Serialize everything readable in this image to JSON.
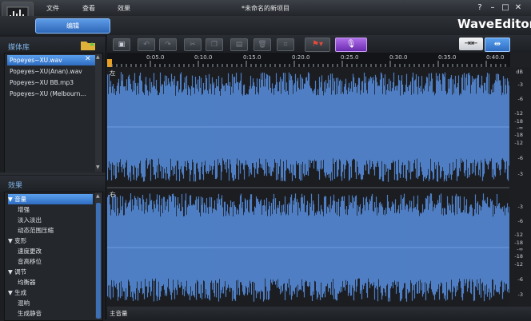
{
  "window": {
    "document_title": "*未命名的新项目",
    "brand": "WaveEditor",
    "menu": [
      "文件",
      "查看",
      "效果"
    ],
    "ribbon_tab": "编辑",
    "controls": {
      "help": "?",
      "minimize": "–",
      "maximize": "□",
      "close": "✕"
    }
  },
  "media_library": {
    "title": "媒体库",
    "files": [
      "Popeyes~XU.wav",
      "Popeyes~XU(Anan).wav",
      "Popeyes~XU BB.mp3",
      "Popeyes~XU (Melbourn..."
    ],
    "selected_index": 0
  },
  "effects": {
    "title": "效果",
    "items": [
      {
        "label": "音量",
        "group": true,
        "expanded": true
      },
      {
        "label": "增强",
        "group": false
      },
      {
        "label": "淡入淡出",
        "group": false
      },
      {
        "label": "动态范围压缩",
        "group": false
      },
      {
        "label": "变形",
        "group": true,
        "expanded": true
      },
      {
        "label": "速度更改",
        "group": false
      },
      {
        "label": "音高移位",
        "group": false
      },
      {
        "label": "调节",
        "group": true,
        "expanded": true
      },
      {
        "label": "均衡器",
        "group": false
      },
      {
        "label": "生成",
        "group": true,
        "expanded": true
      },
      {
        "label": "混响",
        "group": false
      },
      {
        "label": "生成静音",
        "group": false
      }
    ]
  },
  "toolbar": {
    "save_icon": "save-icon",
    "undo_icon": "undo-icon",
    "redo_icon": "redo-icon",
    "cut_icon": "cut-icon",
    "copy_icon": "copy-icon",
    "paste_icon": "paste-icon",
    "delete_icon": "delete-icon",
    "crop_icon": "crop-icon",
    "marker_icon": "flag-icon",
    "record_icon": "microphone-icon",
    "fit_icon": "fit-selection-icon",
    "fit_all_icon": "fit-all-icon"
  },
  "timeline": {
    "ticks": [
      "0:05.0",
      "0:10.0",
      "0:15.0",
      "0:20.0",
      "0:25.0",
      "0:30.0",
      "0:35.0",
      "0:40.0"
    ]
  },
  "tracks": [
    {
      "label": "左",
      "db_labels": [
        "dB",
        "-3",
        "-6",
        "-12",
        "-18",
        "-∞",
        "-18",
        "-12",
        "-6",
        "-3"
      ]
    },
    {
      "label": "右",
      "db_labels": [
        "-3",
        "-6",
        "-12",
        "-18",
        "-∞",
        "-18",
        "-12",
        "-6",
        "-3"
      ]
    }
  ],
  "master": {
    "label": "主音量"
  },
  "colors": {
    "accent": "#3b82e0",
    "waveform": "#4f7fc4",
    "record": "#9b4fe0"
  }
}
